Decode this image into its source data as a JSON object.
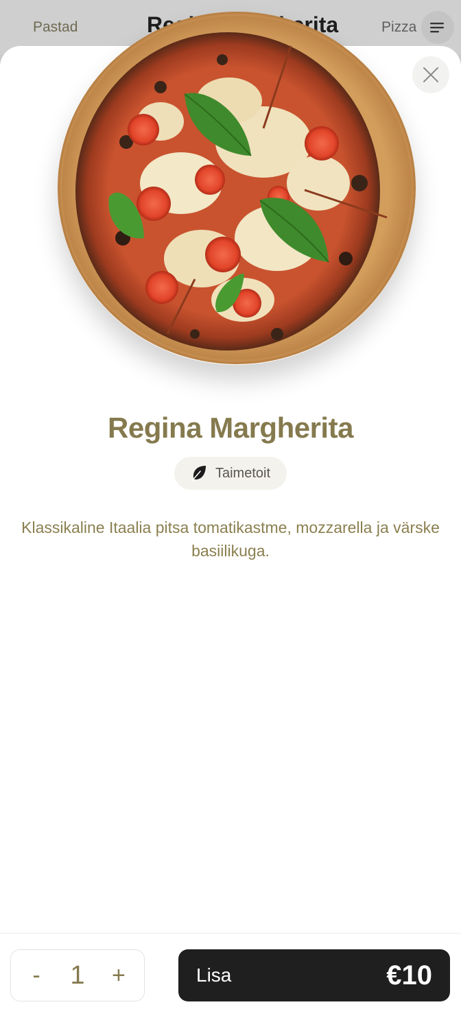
{
  "header": {
    "tab_left": "Pastad",
    "title": "Regina Margherita",
    "tab_right": "Pizza",
    "menu_icon": "menu-icon"
  },
  "item": {
    "image_icon": "pizza-photo",
    "name": "Regina Margherita",
    "tag_label": "Taimetoit",
    "tag_icon": "leaf-icon",
    "description": "Klassikaline Itaalia pitsa tomatikastme, mozzarella ja värske basiilikuga."
  },
  "footer": {
    "minus_label": "-",
    "quantity": "1",
    "plus_label": "+",
    "add_label": "Lisa",
    "price": "€10"
  },
  "colors": {
    "accent": "#857a4e",
    "button_dark": "#1f1f1f",
    "overlay": "#cfcfcf"
  }
}
